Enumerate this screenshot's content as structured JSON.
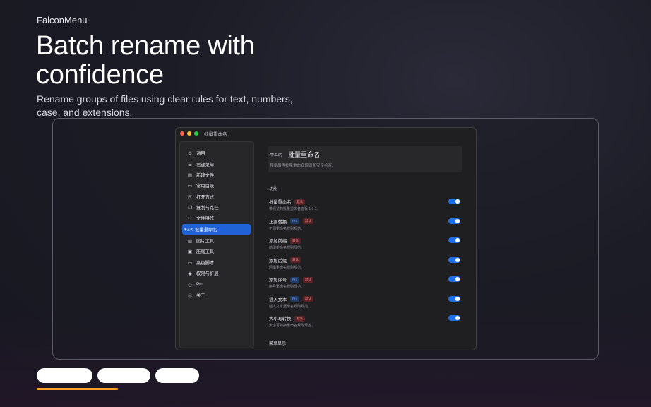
{
  "brand": "FalconMenu",
  "headline": "Batch rename with confidence",
  "subtitle": "Rename groups of files using clear rules for text, numbers, case, and extensions.",
  "window": {
    "title": "批量重命名",
    "traffic_lights": {
      "close": "#fe5f57",
      "minimize": "#febc2e",
      "zoom": "#28c840"
    }
  },
  "sidebar": {
    "items": [
      {
        "icon": "gear-icon",
        "glyph": "⚙",
        "label": "通用"
      },
      {
        "icon": "menu-list-icon",
        "glyph": "☰",
        "label": "右键菜单"
      },
      {
        "icon": "new-file-icon",
        "glyph": "▤",
        "label": "新建文件"
      },
      {
        "icon": "folder-icon",
        "glyph": "▭",
        "label": "常用目录"
      },
      {
        "icon": "open-with-icon",
        "glyph": "⇱",
        "label": "打开方式"
      },
      {
        "icon": "copy-icon",
        "glyph": "❐",
        "label": "复制与路径"
      },
      {
        "icon": "tools-icon",
        "glyph": "✂",
        "label": "文件操作"
      },
      {
        "icon": "rename-icon",
        "glyph": "甲乙丙",
        "label": "批量重命名"
      },
      {
        "icon": "image-icon",
        "glyph": "▨",
        "label": "图片工具"
      },
      {
        "icon": "archive-icon",
        "glyph": "▣",
        "label": "压缩工具"
      },
      {
        "icon": "script-icon",
        "glyph": "▭",
        "label": "高级脚本"
      },
      {
        "icon": "permission-icon",
        "glyph": "◉",
        "label": "权限与扩展"
      },
      {
        "icon": "pro-icon",
        "glyph": "○",
        "label": "Pro"
      },
      {
        "icon": "info-icon",
        "glyph": "ⓘ",
        "label": "关于"
      }
    ],
    "active_index": 7
  },
  "header": {
    "icon_text": "甲乙丙",
    "title": "批量重命名",
    "description": "预览后再批量重命名规则和安全检查。"
  },
  "section_features": "功能",
  "features": [
    {
      "title": "批量重命名",
      "badges": [
        {
          "text": "默认",
          "kind": "def"
        }
      ],
      "description": "带预览的批量重命名面板 1.0.7。",
      "enabled": true
    },
    {
      "title": "正则替换",
      "badges": [
        {
          "text": "Pro",
          "kind": "pro"
        },
        {
          "text": "默认",
          "kind": "def"
        }
      ],
      "description": "正则重命名规则规范。",
      "enabled": true
    },
    {
      "title": "添加前缀",
      "badges": [
        {
          "text": "默认",
          "kind": "def"
        }
      ],
      "description": "前缀重命名规则规范。",
      "enabled": true
    },
    {
      "title": "添加后缀",
      "badges": [
        {
          "text": "默认",
          "kind": "def"
        }
      ],
      "description": "后缀重命名规则规范。",
      "enabled": true
    },
    {
      "title": "添加序号",
      "badges": [
        {
          "text": "Pro",
          "kind": "pro"
        },
        {
          "text": "默认",
          "kind": "def"
        }
      ],
      "description": "序号重命名规则规范。",
      "enabled": true
    },
    {
      "title": "插入文本",
      "badges": [
        {
          "text": "Pro",
          "kind": "pro"
        },
        {
          "text": "默认",
          "kind": "def"
        }
      ],
      "description": "插入文本重命名规则规范。",
      "enabled": true
    },
    {
      "title": "大小写转换",
      "badges": [
        {
          "text": "默认",
          "kind": "def"
        }
      ],
      "description": "大小写转换重命名规则规范。",
      "enabled": true
    }
  ],
  "section_menu": "菜单显示",
  "cta_buttons": [
    {
      "label": ""
    },
    {
      "label": ""
    },
    {
      "label": ""
    }
  ],
  "colors": {
    "accent": "#1f63d6",
    "toggle_on": "#1f6fe6",
    "underline": "#ff9d1c",
    "background": "#191923"
  }
}
